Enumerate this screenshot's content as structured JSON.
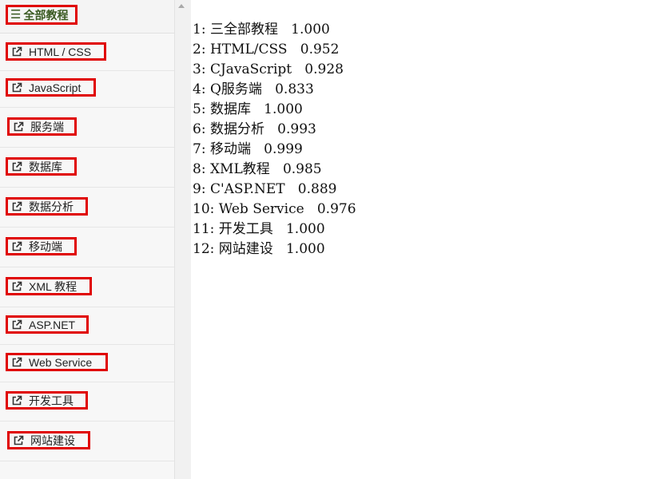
{
  "sidebar": {
    "header": {
      "icon": "list-icon",
      "title": "全部教程"
    },
    "items": [
      {
        "label": "HTML / CSS",
        "icon": "external-link-icon"
      },
      {
        "label": "JavaScript",
        "icon": "external-link-icon"
      },
      {
        "label": "服务端",
        "icon": "external-link-icon"
      },
      {
        "label": "数据库",
        "icon": "external-link-icon"
      },
      {
        "label": "数据分析",
        "icon": "external-link-icon"
      },
      {
        "label": "移动端",
        "icon": "external-link-icon"
      },
      {
        "label": "XML 教程",
        "icon": "external-link-icon"
      },
      {
        "label": "ASP.NET",
        "icon": "external-link-icon"
      },
      {
        "label": "Web Service",
        "icon": "external-link-icon"
      },
      {
        "label": "开发工具",
        "icon": "external-link-icon"
      },
      {
        "label": "网站建设",
        "icon": "external-link-icon"
      }
    ]
  },
  "output": {
    "lines": [
      "1: 三全部教程   1.000",
      "2: HTML/CSS   0.952",
      "3: CJavaScript   0.928",
      "4: Q服务端   0.833",
      "5: 数据库   1.000",
      "6: 数据分析   0.993",
      "7: 移动端   0.999",
      "8: XML教程   0.985",
      "9: C'ASP.NET   0.889",
      "10: Web Service   0.976",
      "11: 开发工具   1.000",
      "12: 网站建设   1.000"
    ]
  },
  "colors": {
    "highlight_border": "#e00000",
    "header_text": "#3a5a22",
    "sidebar_bg": "#f7f7f7"
  }
}
